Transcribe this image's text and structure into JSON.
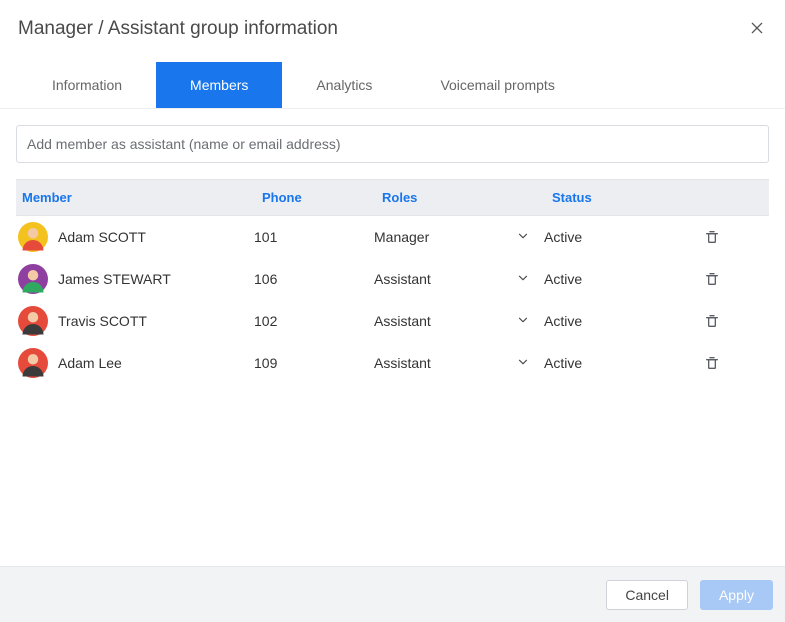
{
  "title": "Manager / Assistant group information",
  "tabs": [
    {
      "label": "Information",
      "active": false
    },
    {
      "label": "Members",
      "active": true
    },
    {
      "label": "Analytics",
      "active": false
    },
    {
      "label": "Voicemail prompts",
      "active": false
    }
  ],
  "add_placeholder": "Add member as assistant (name or email address)",
  "columns": {
    "member": "Member",
    "phone": "Phone",
    "roles": "Roles",
    "status": "Status"
  },
  "rows": [
    {
      "name": "Adam SCOTT",
      "phone": "101",
      "role": "Manager",
      "status": "Active",
      "avatar_bg": "#f4c21f",
      "avatar_body": "#e64a3b"
    },
    {
      "name": "James STEWART",
      "phone": "106",
      "role": "Assistant",
      "status": "Active",
      "avatar_bg": "#8f3fa0",
      "avatar_body": "#2fa860"
    },
    {
      "name": "Travis SCOTT",
      "phone": "102",
      "role": "Assistant",
      "status": "Active",
      "avatar_bg": "#e64a3b",
      "avatar_body": "#3b3b3b"
    },
    {
      "name": "Adam Lee",
      "phone": "109",
      "role": "Assistant",
      "status": "Active",
      "avatar_bg": "#e64a3b",
      "avatar_body": "#3b3b3b"
    }
  ],
  "footer": {
    "cancel": "Cancel",
    "apply": "Apply"
  }
}
